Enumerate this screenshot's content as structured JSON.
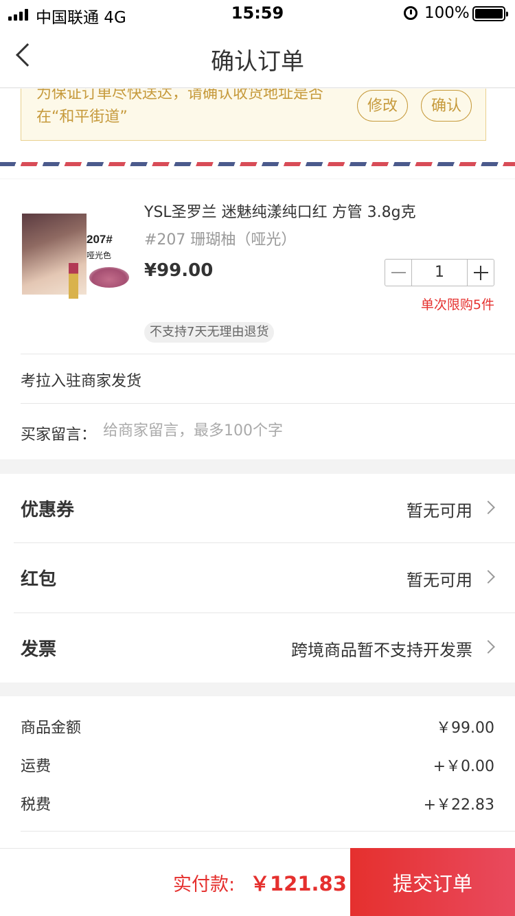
{
  "status_bar": {
    "carrier": "中国联通  4G",
    "time": "15:59",
    "battery": "100%",
    "icons": [
      "signal-icon",
      "alarm-icon",
      "battery-icon"
    ]
  },
  "nav": {
    "title": "确认订单",
    "back_icon": "chevron-left-icon"
  },
  "address_notice": {
    "text": "为保证订单尽快送达，请确认收货地址是否在“和平街道”",
    "modify_label": "修改",
    "confirm_label": "确认"
  },
  "product": {
    "thumb_number": "207#",
    "thumb_shade": "哑光色",
    "name": "YSL圣罗兰 迷魅纯漾纯口红 方管 3.8g克",
    "spec": "#207 珊瑚柚（哑光）",
    "price": "¥99.00",
    "quantity": "1",
    "limit": "单次限购5件",
    "return_tag": "不支持7天无理由退货",
    "merchant": "考拉入驻商家发货",
    "note_label": "买家留言：",
    "note_placeholder": "给商家留言，最多100个字"
  },
  "options": [
    {
      "label": "优惠券",
      "value": "暂无可用"
    },
    {
      "label": "红包",
      "value": "暂无可用"
    },
    {
      "label": "发票",
      "value": "跨境商品暂不支持开发票"
    }
  ],
  "summary": [
    {
      "label": "商品金额",
      "value": "￥99.00"
    },
    {
      "label": "运费",
      "value": "+￥0.00"
    },
    {
      "label": "税费",
      "value": "+￥22.83"
    }
  ],
  "bottom": {
    "pay_label": "实付款:",
    "pay_amount": "￥121.83",
    "submit_label": "提交订单"
  },
  "colors": {
    "accent": "#e5302e",
    "notice_text": "#c69a3c",
    "notice_bg": "#fdf9e9"
  }
}
